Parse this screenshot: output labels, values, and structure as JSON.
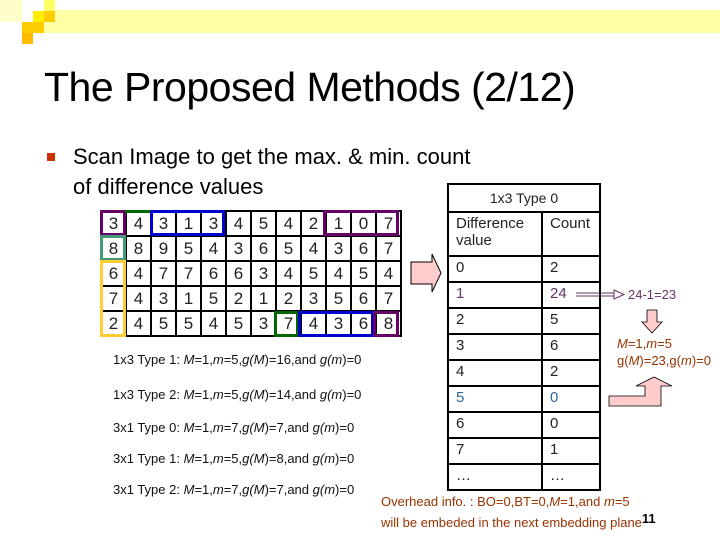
{
  "slide": {
    "title": "The Proposed Methods (2/12)",
    "bullet": "Scan Image to get the max. & min. count of difference values",
    "page_number": "11",
    "colors": {
      "bullet": "#cc3300",
      "band": "#ffff99",
      "arrow_fill": "#ffcccc",
      "note_brown": "#993300",
      "note_purple": "#663366",
      "highlight_purple": "#660066",
      "highlight_blue": "#0000cc",
      "highlight_green": "#006600",
      "highlight_teal": "#449977",
      "highlight_gold": "#ffcc33"
    }
  },
  "grid": {
    "rows": [
      [
        "3",
        "4",
        "3",
        "1",
        "3",
        "4",
        "5",
        "4",
        "2",
        "1",
        "0",
        "7"
      ],
      [
        "8",
        "8",
        "9",
        "5",
        "4",
        "3",
        "6",
        "5",
        "4",
        "3",
        "6",
        "7"
      ],
      [
        "6",
        "4",
        "7",
        "7",
        "6",
        "6",
        "3",
        "4",
        "5",
        "4",
        "5",
        "4"
      ],
      [
        "7",
        "4",
        "3",
        "1",
        "5",
        "2",
        "1",
        "2",
        "3",
        "5",
        "6",
        "7"
      ],
      [
        "2",
        "4",
        "5",
        "5",
        "4",
        "5",
        "3",
        "7",
        "4",
        "3",
        "6",
        "8"
      ]
    ]
  },
  "type_lines": [
    {
      "prefix": "1x3 Type 1: ",
      "M": "1",
      "m": "5",
      "gM": "16",
      "gm": "0"
    },
    {
      "prefix": "1x3 Type 2: ",
      "M": "1",
      "m": "5",
      "gM": "14",
      "gm": "0"
    },
    {
      "prefix": "3x1 Type 0: ",
      "M": "1",
      "m": "7",
      "gM": "7",
      "gm": "0"
    },
    {
      "prefix": "3x1 Type 1: ",
      "M": "1",
      "m": "5",
      "gM": "8",
      "gm": "0"
    },
    {
      "prefix": "3x1 Type 2: ",
      "M": "1",
      "m": "7",
      "gM": "7",
      "gm": "0"
    }
  ],
  "histogram": {
    "title": "1x3 Type 0",
    "headers": [
      "Difference value",
      "Count"
    ],
    "rows": [
      {
        "diff": "0",
        "count": "2",
        "style": ""
      },
      {
        "diff": "1",
        "count": "24",
        "style": "purple"
      },
      {
        "diff": "2",
        "count": "5",
        "style": ""
      },
      {
        "diff": "3",
        "count": "6",
        "style": ""
      },
      {
        "diff": "4",
        "count": "2",
        "style": ""
      },
      {
        "diff": "5",
        "count": "0",
        "style": "teal"
      },
      {
        "diff": "6",
        "count": "0",
        "style": ""
      },
      {
        "diff": "7",
        "count": "1",
        "style": ""
      },
      {
        "diff": "…",
        "count": "…",
        "style": ""
      }
    ]
  },
  "notes": {
    "calc": "24-1=23",
    "result_line1": "M=1,m=5",
    "result_line2": "g(M)=23,g(m)=0"
  },
  "overhead": {
    "line1": "Overhead info. : BO=0,BT=0,M=1,and m=5",
    "line2": "will be embeded in the next embedding plane"
  }
}
